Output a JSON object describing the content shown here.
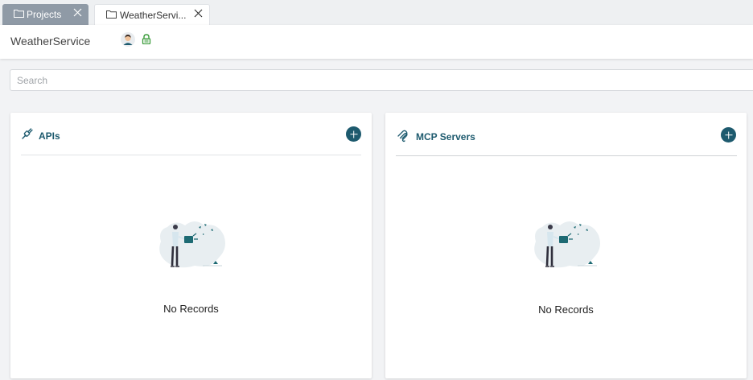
{
  "tabs": [
    {
      "label": "Projects",
      "active": false
    },
    {
      "label": "WeatherServi...",
      "active": true
    }
  ],
  "header": {
    "project_name": "WeatherService"
  },
  "search": {
    "placeholder": "Search",
    "value": ""
  },
  "cards": {
    "apis": {
      "title": "APIs",
      "icon": "plug-icon",
      "empty_text": "No Records"
    },
    "mcp": {
      "title": "MCP Servers",
      "icon": "mcp-icon",
      "empty_text": "No Records"
    }
  },
  "colors": {
    "accent": "#1d5a6e",
    "tab_inactive": "#8f9aa6",
    "lock_green": "#3a9b3a"
  }
}
